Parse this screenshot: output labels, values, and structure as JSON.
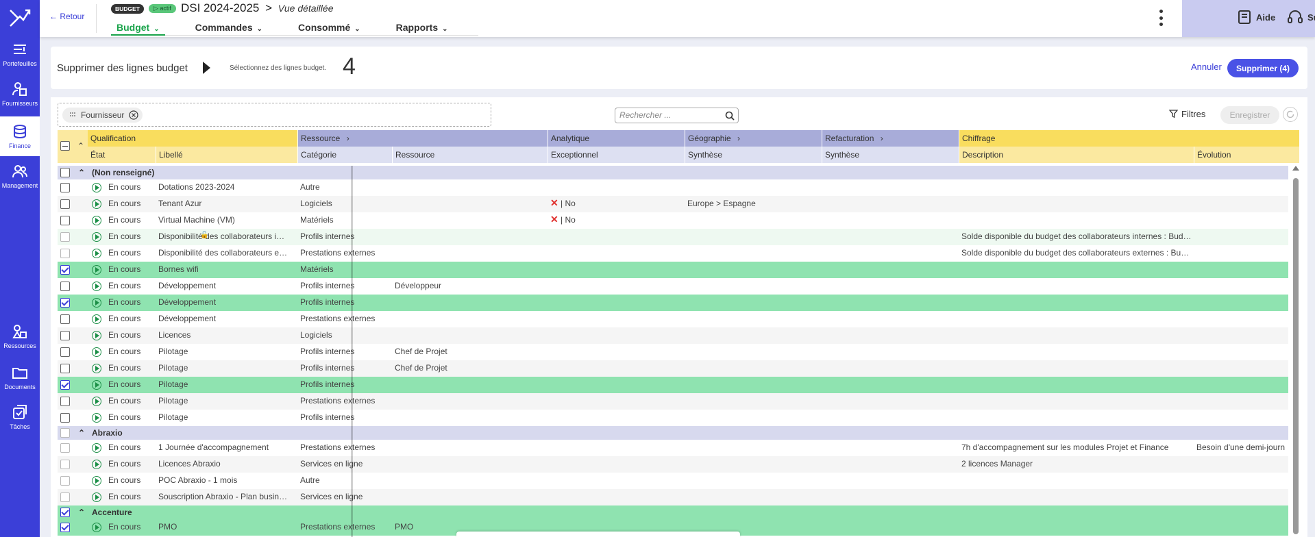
{
  "sidebar": {
    "items": [
      {
        "label": "Portefeuilles",
        "icon": "portfolio-icon"
      },
      {
        "label": "Fournisseurs",
        "icon": "supplier-icon"
      },
      {
        "label": "Finance",
        "icon": "finance-icon",
        "active": true
      },
      {
        "label": "Management",
        "icon": "management-icon"
      },
      {
        "label": "Ressources",
        "icon": "resources-icon"
      },
      {
        "label": "Documents",
        "icon": "folder-icon"
      },
      {
        "label": "Tâches",
        "icon": "tasks-icon"
      }
    ]
  },
  "header": {
    "back": "← Retour",
    "badge": "BUDGET",
    "status": "▷ actif",
    "title": "DSI 2024-2025",
    "separator": ">",
    "subtitle": "Vue détaillée",
    "nav": [
      "Budget",
      "Commandes",
      "Consommé",
      "Rapports"
    ],
    "active_nav": "Budget",
    "help": "Aide",
    "support": "Support"
  },
  "action": {
    "title": "Supprimer des lignes budget",
    "hint": "Sélectionnez des lignes budget.",
    "count": "4",
    "cancel": "Annuler",
    "delete": "Supprimer (4)"
  },
  "toolbar": {
    "group_chip": "Fournisseur",
    "search_placeholder": "Rechercher ...",
    "filters": "Filtres",
    "save": "Enregistrer"
  },
  "grid": {
    "groups": [
      "Qualification",
      "Ressource",
      "Analytique",
      "Géographie",
      "Refacturation",
      "Chiffrage"
    ],
    "columns": [
      "État",
      "Libellé",
      "Catégorie",
      "Ressource",
      "Exceptionnel",
      "Synthèse",
      "Synthèse",
      "Description",
      "Évolution"
    ],
    "rows": [
      {
        "type": "group",
        "label": "(Non renseigné)",
        "checked": false
      },
      {
        "etat": "En cours",
        "libelle": "Dotations 2023-2024",
        "categorie": "Autre",
        "ressource": "",
        "exceptionnel": "",
        "geo": "",
        "desc": "",
        "evol": "",
        "checked": false
      },
      {
        "etat": "En cours",
        "libelle": "Tenant Azur",
        "categorie": "Logiciels",
        "ressource": "",
        "exceptionnel": "| No",
        "geo": "Europe > Espagne",
        "desc": "",
        "evol": "",
        "checked": false
      },
      {
        "etat": "En cours",
        "libelle": "Virtual Machine (VM)",
        "categorie": "Matériels",
        "ressource": "",
        "exceptionnel": "| No",
        "geo": "",
        "desc": "",
        "evol": "",
        "checked": false
      },
      {
        "etat": "En cours",
        "libelle": "Disponibilité des collaborateurs i…",
        "categorie": "Profils internes",
        "ressource": "",
        "exceptionnel": "",
        "geo": "",
        "desc": "Solde disponible du budget des collaborateurs internes : Bud…",
        "evol": "",
        "checked": false,
        "locked": true,
        "dim": true
      },
      {
        "etat": "En cours",
        "libelle": "Disponibilité des collaborateurs e…",
        "categorie": "Prestations externes",
        "ressource": "",
        "exceptionnel": "",
        "geo": "",
        "desc": "Solde disponible du budget des collaborateurs externes : Bu…",
        "evol": "",
        "checked": false,
        "dim": true
      },
      {
        "etat": "En cours",
        "libelle": "Bornes wifi",
        "categorie": "Matériels",
        "ressource": "",
        "exceptionnel": "",
        "geo": "",
        "desc": "",
        "evol": "",
        "checked": true
      },
      {
        "etat": "En cours",
        "libelle": "Développement",
        "categorie": "Profils internes",
        "ressource": "Développeur",
        "exceptionnel": "",
        "geo": "",
        "desc": "",
        "evol": "",
        "checked": false
      },
      {
        "etat": "En cours",
        "libelle": "Développement",
        "categorie": "Profils internes",
        "ressource": "",
        "exceptionnel": "",
        "geo": "",
        "desc": "",
        "evol": "",
        "checked": true
      },
      {
        "etat": "En cours",
        "libelle": "Développement",
        "categorie": "Prestations externes",
        "ressource": "",
        "exceptionnel": "",
        "geo": "",
        "desc": "",
        "evol": "",
        "checked": false
      },
      {
        "etat": "En cours",
        "libelle": "Licences",
        "categorie": "Logiciels",
        "ressource": "",
        "exceptionnel": "",
        "geo": "",
        "desc": "",
        "evol": "",
        "checked": false
      },
      {
        "etat": "En cours",
        "libelle": "Pilotage",
        "categorie": "Profils internes",
        "ressource": "Chef de Projet",
        "exceptionnel": "",
        "geo": "",
        "desc": "",
        "evol": "",
        "checked": false
      },
      {
        "etat": "En cours",
        "libelle": "Pilotage",
        "categorie": "Profils internes",
        "ressource": "Chef de Projet",
        "exceptionnel": "",
        "geo": "",
        "desc": "",
        "evol": "",
        "checked": false
      },
      {
        "etat": "En cours",
        "libelle": "Pilotage",
        "categorie": "Profils internes",
        "ressource": "",
        "exceptionnel": "",
        "geo": "",
        "desc": "",
        "evol": "",
        "checked": true
      },
      {
        "etat": "En cours",
        "libelle": "Pilotage",
        "categorie": "Prestations externes",
        "ressource": "",
        "exceptionnel": "",
        "geo": "",
        "desc": "",
        "evol": "",
        "checked": false
      },
      {
        "etat": "En cours",
        "libelle": "Pilotage",
        "categorie": "Profils internes",
        "ressource": "",
        "exceptionnel": "",
        "geo": "",
        "desc": "",
        "evol": "",
        "checked": false
      },
      {
        "type": "group",
        "label": "Abraxio",
        "checked": false,
        "dim": true
      },
      {
        "etat": "En cours",
        "libelle": "1 Journée d'accompagnement",
        "categorie": "Prestations externes",
        "ressource": "",
        "exceptionnel": "",
        "geo": "",
        "desc": "7h d'accompagnement sur les modules Projet et Finance",
        "evol": "Besoin d'une demi-journ",
        "checked": false,
        "dim": true
      },
      {
        "etat": "En cours",
        "libelle": "Licences Abraxio",
        "categorie": "Services en ligne",
        "ressource": "",
        "exceptionnel": "",
        "geo": "",
        "desc": "2 licences Manager",
        "evol": "",
        "checked": false,
        "dim": true
      },
      {
        "etat": "En cours",
        "libelle": "POC Abraxio - 1 mois",
        "categorie": "Autre",
        "ressource": "",
        "exceptionnel": "",
        "geo": "",
        "desc": "",
        "evol": "",
        "checked": false,
        "dim": true
      },
      {
        "etat": "En cours",
        "libelle": "Souscription Abraxio - Plan busin…",
        "categorie": "Services en ligne",
        "ressource": "",
        "exceptionnel": "",
        "geo": "",
        "desc": "",
        "evol": "",
        "checked": false,
        "dim": true
      },
      {
        "type": "group",
        "label": "Accenture",
        "checked": true
      },
      {
        "etat": "En cours",
        "libelle": "PMO",
        "categorie": "Prestations externes",
        "ressource": "PMO",
        "exceptionnel": "",
        "geo": "",
        "desc": "",
        "evol": "",
        "checked": true
      }
    ]
  },
  "colors": {
    "brand": "#3b3fd8",
    "selected_row": "#8fe3b0",
    "group_row": "#d7d9ee",
    "header_yellow": "#f9dd5e",
    "header_blue": "#a8acd9",
    "status_green": "#1c8f47",
    "no_red": "#e0312f"
  }
}
